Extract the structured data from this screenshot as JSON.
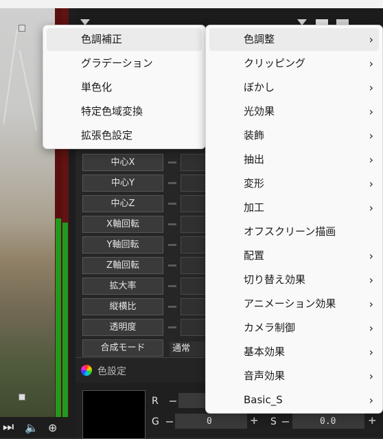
{
  "panel": {
    "properties": [
      "中心X",
      "中心Y",
      "中心Z",
      "X軸回転",
      "Y軸回転",
      "Z軸回転",
      "拡大率",
      "縦横比",
      "透明度",
      "合成モード"
    ],
    "blend_mode_value": "通常"
  },
  "color_settings": {
    "title": "色設定",
    "r_label": "R",
    "g_label": "G",
    "g_value": "0",
    "s_label": "S",
    "s_value": "0.0"
  },
  "submenu": {
    "items": [
      {
        "label": "色調補正",
        "highlighted": true
      },
      {
        "label": "グラデーション"
      },
      {
        "label": "単色化"
      },
      {
        "label": "特定色域変換"
      },
      {
        "label": "拡張色設定"
      }
    ]
  },
  "main_menu": {
    "items": [
      {
        "label": "色調整",
        "arrow": "›",
        "highlighted": true
      },
      {
        "label": "クリッピング",
        "arrow": "›"
      },
      {
        "label": "ぼかし",
        "arrow": "›"
      },
      {
        "label": "光効果",
        "arrow": "›"
      },
      {
        "label": "装飾",
        "arrow": "›"
      },
      {
        "label": "抽出",
        "arrow": "›"
      },
      {
        "label": "変形",
        "arrow": "›"
      },
      {
        "label": "加工",
        "arrow": "›"
      },
      {
        "label": "オフスクリーン描画"
      },
      {
        "label": "配置",
        "arrow": "›"
      },
      {
        "label": "切り替え効果",
        "arrow": "›"
      },
      {
        "label": "アニメーション効果",
        "arrow": "›"
      },
      {
        "label": "カメラ制御",
        "arrow": "›"
      },
      {
        "label": "基本効果",
        "arrow": "›"
      },
      {
        "label": "音声効果",
        "arrow": "›"
      },
      {
        "label": "Basic_S",
        "arrow": "›"
      }
    ]
  },
  "icons": {
    "bottom_bar": [
      "skip-end-icon",
      "speaker-icon",
      "zoom-in-icon"
    ],
    "panel_header": [
      "dropdown-triangle-icon",
      "list-view-icon"
    ],
    "color_panel": "color-wheel-icon"
  }
}
